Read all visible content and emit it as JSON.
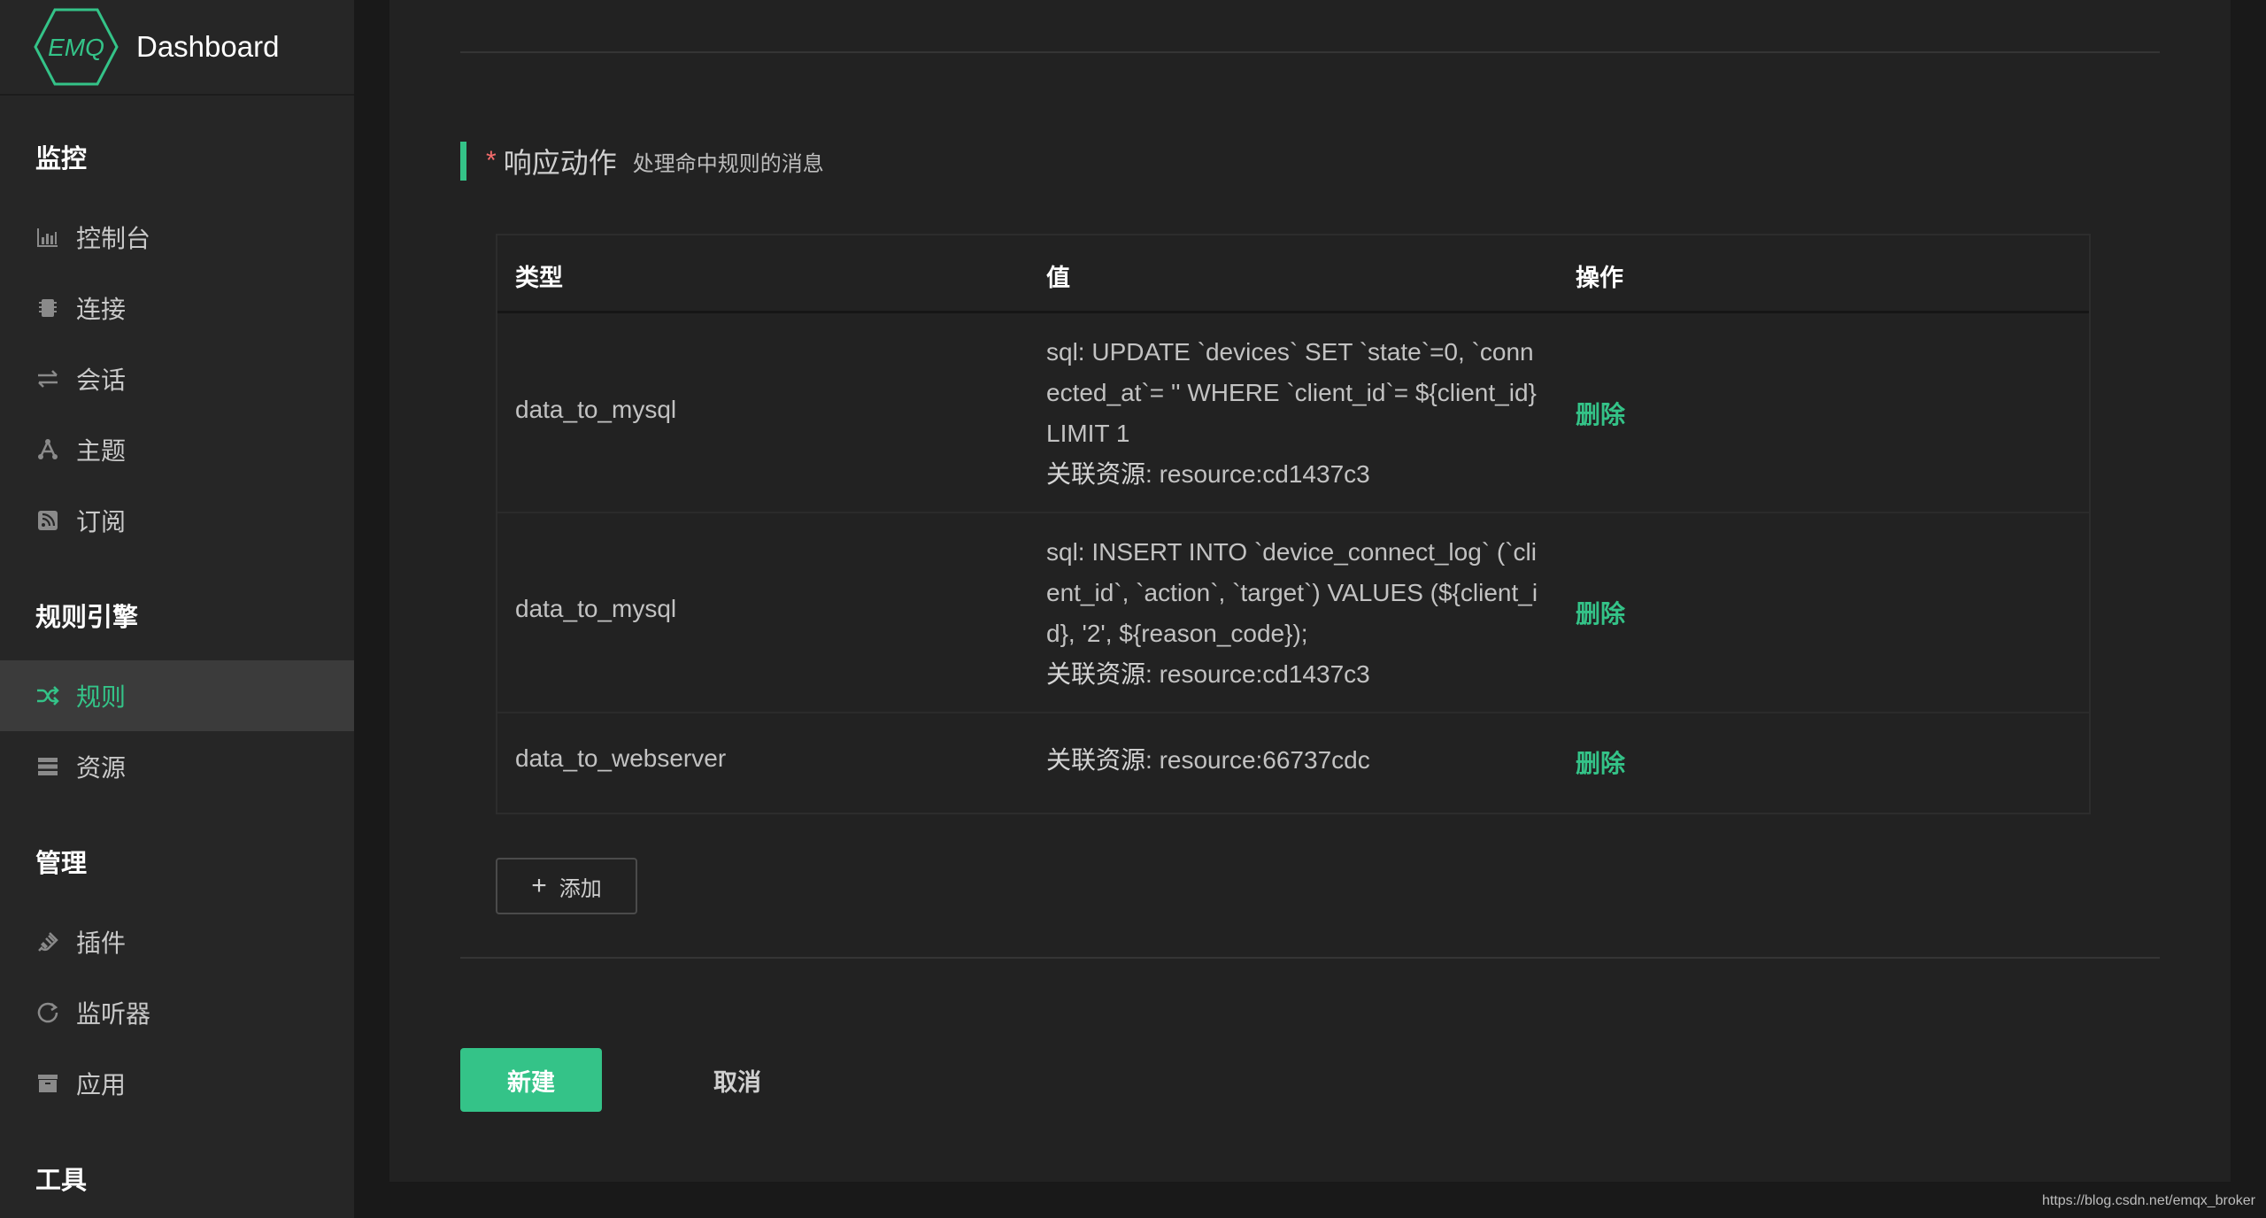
{
  "app": {
    "logo_text": "EMQ",
    "title": "Dashboard"
  },
  "sidebar": {
    "groups": [
      {
        "title": "监控",
        "items": [
          {
            "label": "控制台",
            "icon": "bar-chart-icon"
          },
          {
            "label": "连接",
            "icon": "chip-icon"
          },
          {
            "label": "会话",
            "icon": "swap-arrows-icon"
          },
          {
            "label": "主题",
            "icon": "topic-icon"
          },
          {
            "label": "订阅",
            "icon": "rss-icon"
          }
        ]
      },
      {
        "title": "规则引擎",
        "items": [
          {
            "label": "规则",
            "icon": "shuffle-icon",
            "active": true
          },
          {
            "label": "资源",
            "icon": "server-icon"
          }
        ]
      },
      {
        "title": "管理",
        "items": [
          {
            "label": "插件",
            "icon": "plug-icon"
          },
          {
            "label": "监听器",
            "icon": "refresh-circle-icon"
          },
          {
            "label": "应用",
            "icon": "archive-icon"
          }
        ]
      },
      {
        "title": "工具",
        "items": []
      }
    ]
  },
  "section": {
    "required_mark": "*",
    "title": "响应动作",
    "subtitle": "处理命中规则的消息"
  },
  "table": {
    "headers": {
      "type": "类型",
      "value": "值",
      "action": "操作"
    },
    "rows": [
      {
        "type": "data_to_mysql",
        "value": "sql: UPDATE `devices` SET `state`=0, `connected_at`= '' WHERE `client_id`= ${client_id} LIMIT 1",
        "resource_label": "关联资源",
        "resource": ": resource:cd1437c3",
        "action": "删除"
      },
      {
        "type": "data_to_mysql",
        "value": "sql: INSERT INTO `device_connect_log` (`client_id`, `action`, `target`) VALUES (${client_id}, '2', ${reason_code});",
        "resource_label": "关联资源",
        "resource": ": resource:cd1437c3",
        "action": "删除"
      },
      {
        "type": "data_to_webserver",
        "value": "",
        "resource_label": "关联资源",
        "resource": ": resource:66737cdc",
        "action": "删除"
      }
    ]
  },
  "buttons": {
    "add_symbol": "+",
    "add": "添加",
    "create": "新建",
    "cancel": "取消"
  },
  "watermark": "https://blog.csdn.net/emqx_broker",
  "colors": {
    "accent": "#34c388",
    "required": "#f56c6c",
    "sidebar_bg": "#262626",
    "panel_bg": "#222222",
    "page_bg": "#191919"
  }
}
